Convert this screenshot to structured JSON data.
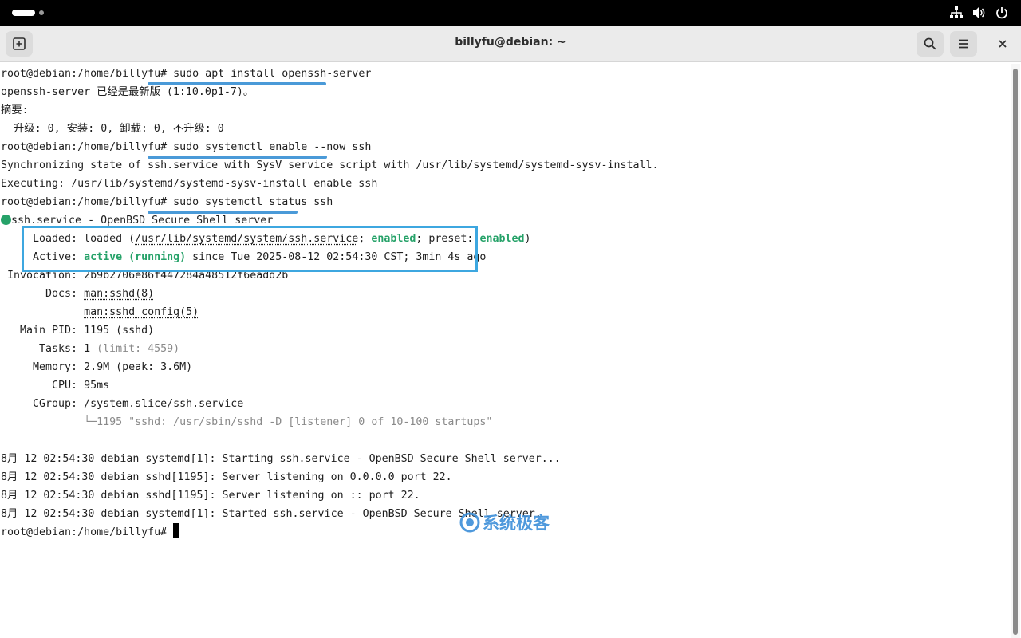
{
  "window": {
    "title": "billyfu@debian: ~"
  },
  "icons": {
    "new_tab": "new-tab-icon",
    "search": "search-icon",
    "menu": "hamburger-menu-icon",
    "close": "close-icon",
    "network": "network-icon",
    "volume": "volume-icon",
    "power": "power-icon"
  },
  "colors": {
    "highlight": "#3da7e0",
    "status_green": "#26a269",
    "watermark": "#3d8fd9"
  },
  "terminal": {
    "prompt": "root@debian:/home/billyfu#",
    "cmd1": "sudo apt install openssh-server",
    "out1_1": "openssh-server 已经是最新版 (1:10.0p1-7)。",
    "out1_2": "摘要:",
    "out1_3": "  升级: 0, 安装: 0, 卸载: 0, 不升级: 0",
    "cmd2": "sudo systemctl enable --now ssh",
    "out2_1": "Synchronizing state of ssh.service with SysV service script with /usr/lib/systemd/systemd-sysv-install.",
    "out2_2": "Executing: /usr/lib/systemd/systemd-sysv-install enable ssh",
    "cmd3": "sudo systemctl status ssh",
    "status_title": "ssh.service - OpenBSD Secure Shell server",
    "loaded_label": "     Loaded: ",
    "loaded_pre": "loaded (",
    "loaded_path": "/usr/lib/systemd/system/ssh.service",
    "loaded_sep": "; ",
    "enabled": "enabled",
    "preset_label": "; preset: ",
    "loaded_post": ")",
    "active_label": "     Active: ",
    "active_state": "active (running)",
    "active_since": " since Tue 2025-08-12 02:54:30 CST; 3min 4s ago",
    "invocation_label": " Invocation: ",
    "invocation": "2b9b2706e86f447284a48512f6eadd2b",
    "docs_label": "       Docs: ",
    "docs1": "man:sshd(8)",
    "docs_indent": "             ",
    "docs2": "man:sshd_config(5)",
    "pid_label": "   Main PID: ",
    "pid": "1195 (sshd)",
    "tasks_label": "      Tasks: ",
    "tasks": "1",
    "tasks_limit": " (limit: 4559)",
    "memory_label": "     Memory: ",
    "memory": "2.9M (peak: 3.6M)",
    "cpu_label": "        CPU: ",
    "cpu": "95ms",
    "cgroup_label": "     CGroup: ",
    "cgroup": "/system.slice/ssh.service",
    "cgroup_child": "             └─1195 \"sshd: /usr/sbin/sshd -D [listener] 0 of 10-100 startups\"",
    "log1": "8月 12 02:54:30 debian systemd[1]: Starting ssh.service - OpenBSD Secure Shell server...",
    "log2": "8月 12 02:54:30 debian sshd[1195]: Server listening on 0.0.0.0 port 22.",
    "log3": "8月 12 02:54:30 debian sshd[1195]: Server listening on :: port 22.",
    "log4": "8月 12 02:54:30 debian systemd[1]: Started ssh.service - OpenBSD Secure Shell server."
  },
  "watermark": {
    "text": "系统极客"
  }
}
